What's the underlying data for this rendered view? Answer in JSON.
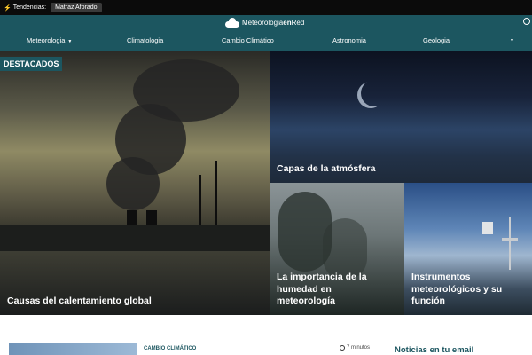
{
  "topbar": {
    "label": "Tendencias:",
    "trend_tag": "Matraz Aforado"
  },
  "header": {
    "brand_normal_1": "Meteorologia",
    "brand_bold": "en",
    "brand_normal_2": "Red",
    "nav": [
      {
        "label": "Meteorologia"
      },
      {
        "label": "Climatologia"
      },
      {
        "label": "Cambio Climático"
      },
      {
        "label": "Astronomia"
      },
      {
        "label": "Geologia"
      }
    ],
    "more_caret": "▼"
  },
  "featured": {
    "badge": "DESTACADOS",
    "tiles": [
      {
        "title": "Causas del calentamiento global"
      },
      {
        "title": "Capas de la atmósfera"
      },
      {
        "title": "La importancia de la humedad en meteorología"
      },
      {
        "title": "Instrumentos meteorológicos y su función"
      }
    ]
  },
  "article": {
    "category": "CAMBIO CLIMÁTICO",
    "read_time": "7 minutos"
  },
  "sidebar": {
    "newsletter_title": "Noticias en tu email"
  }
}
